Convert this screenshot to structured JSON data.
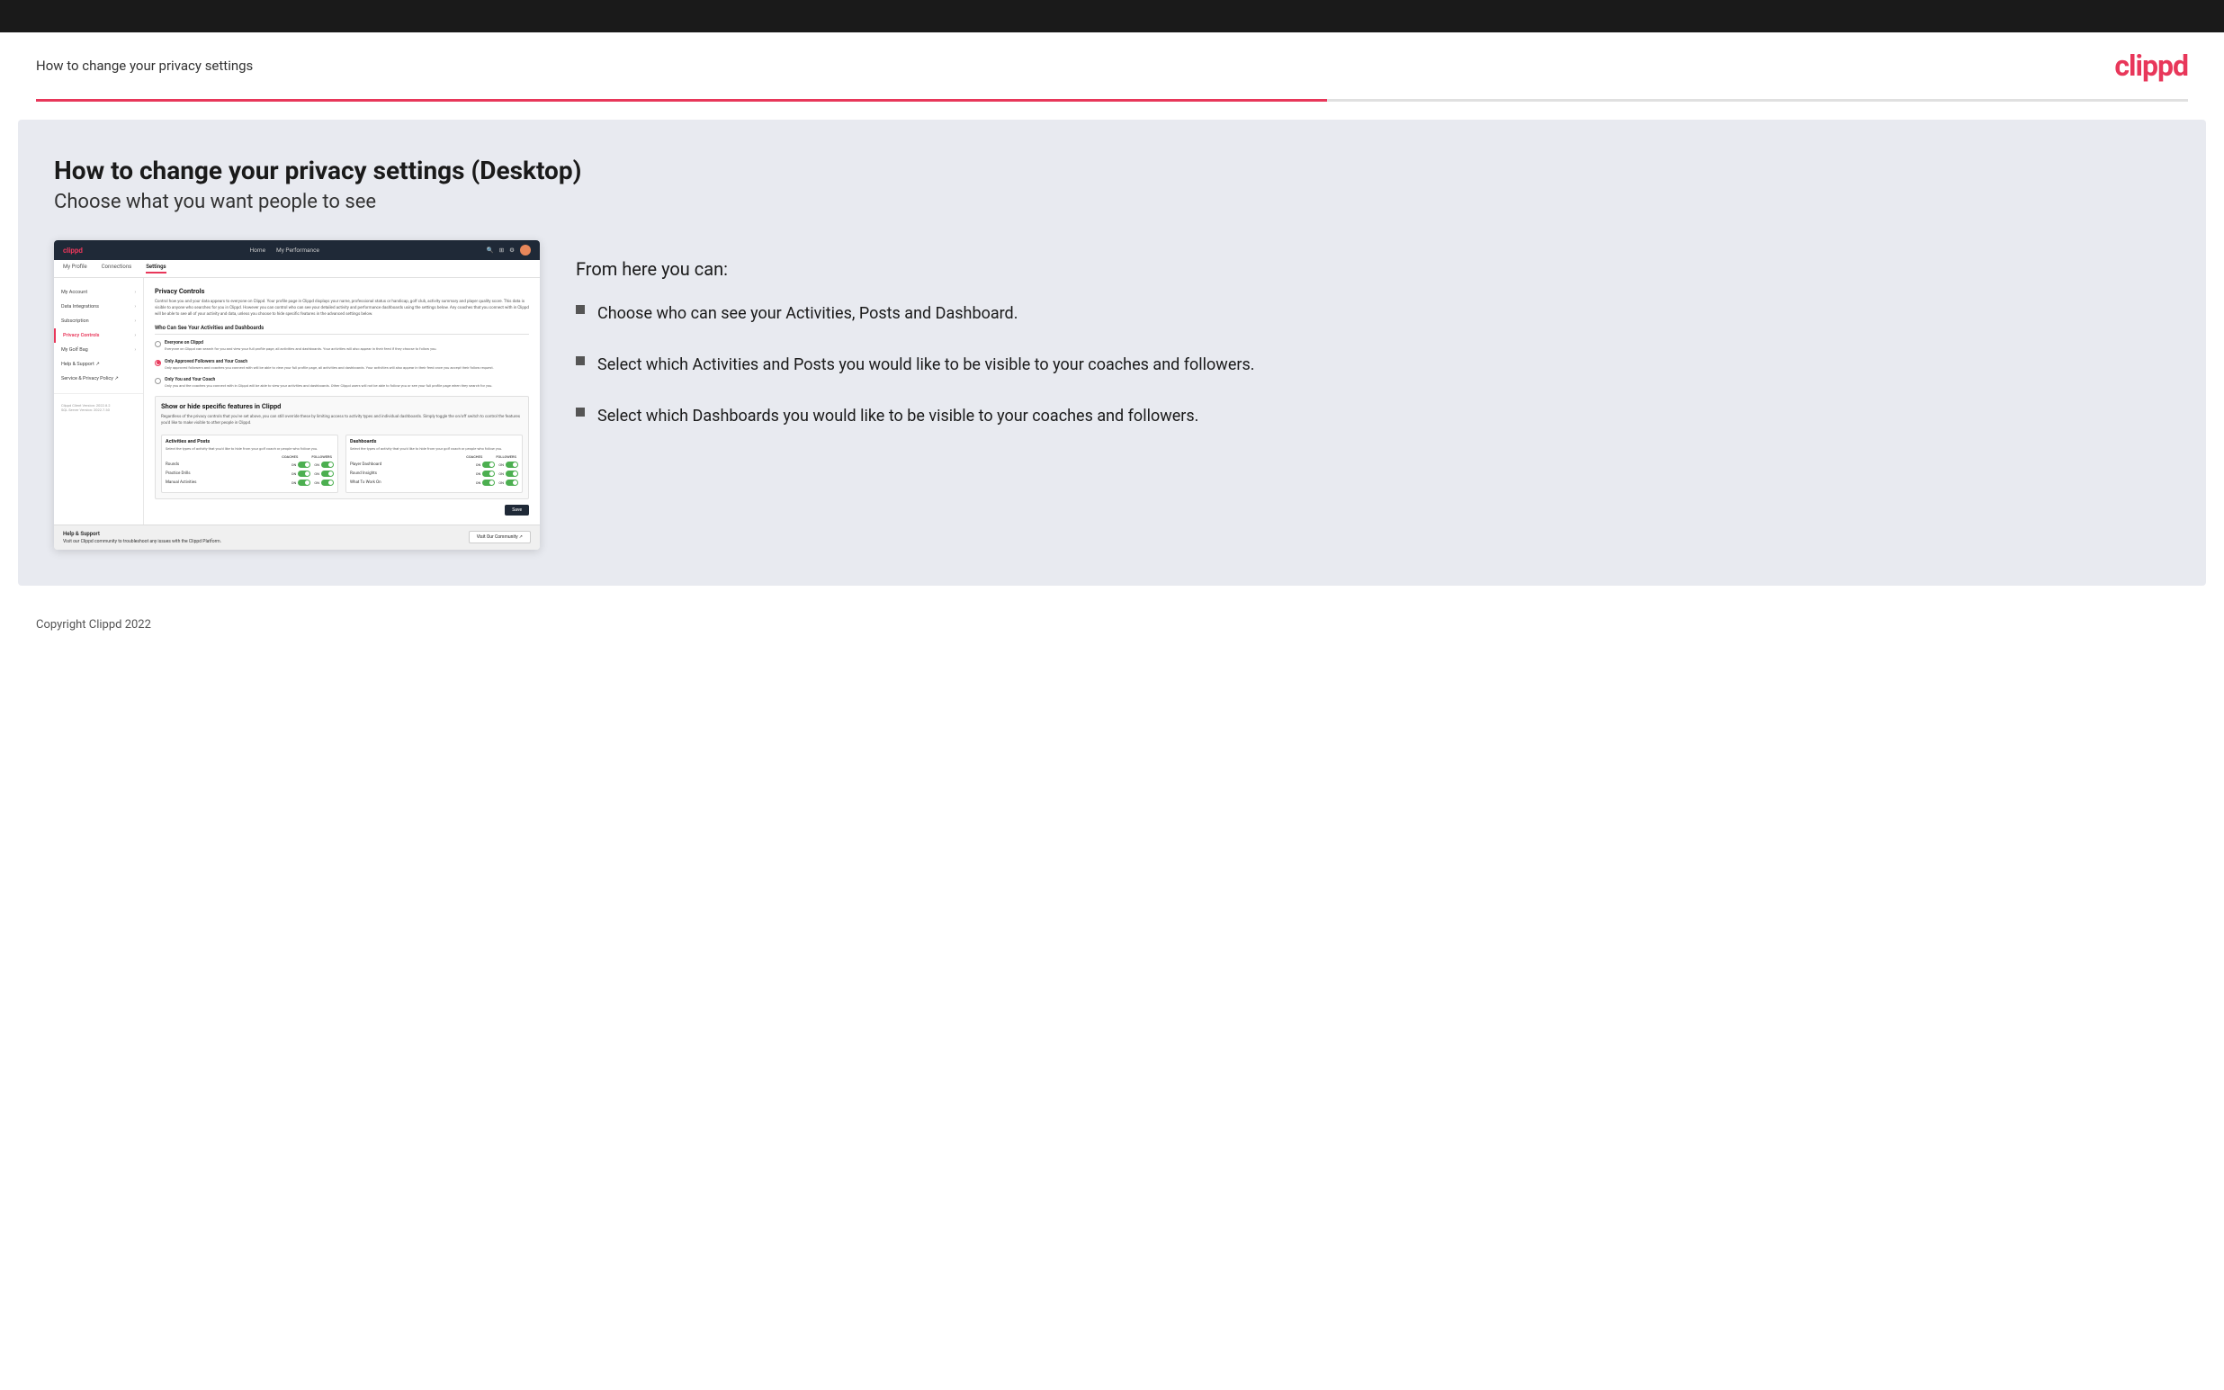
{
  "header": {
    "title": "How to change your privacy settings",
    "logo": "clippd"
  },
  "main": {
    "heading": "How to change your privacy settings (Desktop)",
    "subheading": "Choose what you want people to see",
    "info_intro": "From here you can:",
    "bullets": [
      {
        "text": "Choose who can see your Activities, Posts and Dashboard."
      },
      {
        "text": "Select which Activities and Posts you would like to be visible to your coaches and followers."
      },
      {
        "text": "Select which Dashboards you would like to be visible to your coaches and followers."
      }
    ]
  },
  "mockup": {
    "nav": {
      "logo": "clippd",
      "links": [
        "Home",
        "My Performance"
      ],
      "icons": [
        "search",
        "grid",
        "settings",
        "avatar"
      ]
    },
    "subnav": {
      "items": [
        "My Profile",
        "Connections",
        "Settings"
      ]
    },
    "sidebar": {
      "items": [
        {
          "label": "My Account",
          "active": false
        },
        {
          "label": "Data Integrations",
          "active": false
        },
        {
          "label": "Subscription",
          "active": false
        },
        {
          "label": "Privacy Controls",
          "active": true
        },
        {
          "label": "My Golf Bag",
          "active": false
        },
        {
          "label": "Help & Support",
          "active": false,
          "external": true
        },
        {
          "label": "Service & Privacy Policy",
          "active": false,
          "external": true
        }
      ],
      "version": "Clippd Client Version: 2022.8.2\nSQL Server Version: 2022.7.30"
    },
    "main": {
      "section_title": "Privacy Controls",
      "section_desc": "Control how you and your data appears to everyone on Clippd. Your profile page in Clippd displays your name, professional status or handicap, golf club, activity summary and player quality score. This data is visible to anyone who searches for you in Clippd. However you can control who can see your detailed activity and performance dashboards using the settings below. Any coaches that you connect with in Clippd will be able to see all of your activity and data, unless you choose to hide specific features in the advanced settings below.",
      "who_section_title": "Who Can See Your Activities and Dashboards",
      "radio_options": [
        {
          "label": "Everyone on Clippd",
          "desc": "Everyone on Clippd can search for you and view your full profile page, all activities and dashboards. Your activities will also appear in their feed if they choose to follow you.",
          "selected": false
        },
        {
          "label": "Only Approved Followers and Your Coach",
          "desc": "Only approved followers and coaches you connect with will be able to view your full profile page, all activities and dashboards. Your activities will also appear in their feed once you accept their follow request.",
          "selected": true
        },
        {
          "label": "Only You and Your Coach",
          "desc": "Only you and the coaches you connect with in Clippd will be able to view your activities and dashboards. Other Clippd users will not be able to follow you or see your full profile page when they search for you.",
          "selected": false
        }
      ],
      "show_hide_title": "Show or hide specific features in Clippd",
      "show_hide_desc": "Regardless of the privacy controls that you've set above, you can still override these by limiting access to activity types and individual dashboards. Simply toggle the on/off switch to control the features you'd like to make visible to other people in Clippd.",
      "activities_posts": {
        "title": "Activities and Posts",
        "desc": "Select the types of activity that you'd like to hide from your golf coach or people who follow you.",
        "headers": [
          "COACHES",
          "FOLLOWERS"
        ],
        "items": [
          {
            "name": "Rounds",
            "coaches_on": true,
            "followers_on": true
          },
          {
            "name": "Practice Drills",
            "coaches_on": true,
            "followers_on": true
          },
          {
            "name": "Manual Activities",
            "coaches_on": true,
            "followers_on": true
          }
        ]
      },
      "dashboards": {
        "title": "Dashboards",
        "desc": "Select the types of activity that you'd like to hide from your golf coach or people who follow you.",
        "headers": [
          "COACHES",
          "FOLLOWERS"
        ],
        "items": [
          {
            "name": "Player Dashboard",
            "coaches_on": true,
            "followers_on": true
          },
          {
            "name": "Round Insights",
            "coaches_on": true,
            "followers_on": true
          },
          {
            "name": "What To Work On",
            "coaches_on": true,
            "followers_on": true
          }
        ]
      },
      "save_button": "Save",
      "help": {
        "title": "Help & Support",
        "desc": "Visit our Clippd community to troubleshoot any issues with the Clippd Platform.",
        "button": "Visit Our Community"
      }
    }
  },
  "footer": {
    "copyright": "Copyright Clippd 2022"
  }
}
